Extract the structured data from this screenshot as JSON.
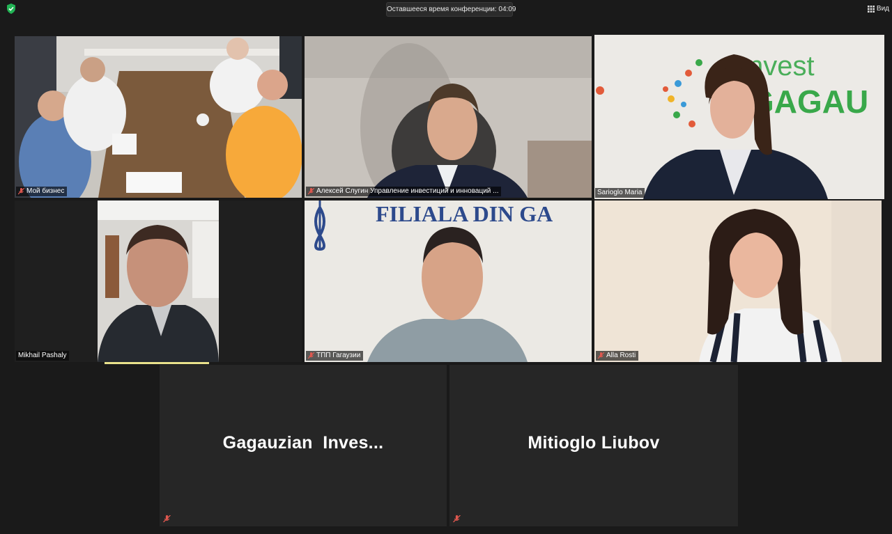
{
  "topbar": {
    "timer_text": "Оставшееся время конференции: 04:09",
    "view_label": "Вид",
    "view_icon": "grid-icon",
    "security_icon": "shield-check-icon"
  },
  "participants": [
    {
      "name": "Мой бизнес",
      "muted": true,
      "video": true
    },
    {
      "name": "Алексей Слугин Управление инвестиций и инноваций ...",
      "muted": true,
      "video": true
    },
    {
      "name": "Sarioglo Maria",
      "muted": false,
      "video": true,
      "active_speaker": true
    },
    {
      "name": "Mikhail Pashaly",
      "muted": false,
      "video": true
    },
    {
      "name": "ТПП Гагаузии",
      "muted": true,
      "video": true
    },
    {
      "name": "Alla Rosti",
      "muted": true,
      "video": true
    },
    {
      "name": "Gagauzian  Inves...",
      "muted": true,
      "video": false
    },
    {
      "name": "Mitioglo Liubov",
      "muted": true,
      "video": false
    }
  ],
  "backgrounds": {
    "invest_sign_top": "nvest",
    "invest_sign_bottom": "GAGAU",
    "filiala_sign": "FILIALA DIN GA"
  },
  "colors": {
    "active_speaker_border": "#c8e06a",
    "muted_mic": "#e0584f",
    "invest_green": "#39a84a"
  }
}
